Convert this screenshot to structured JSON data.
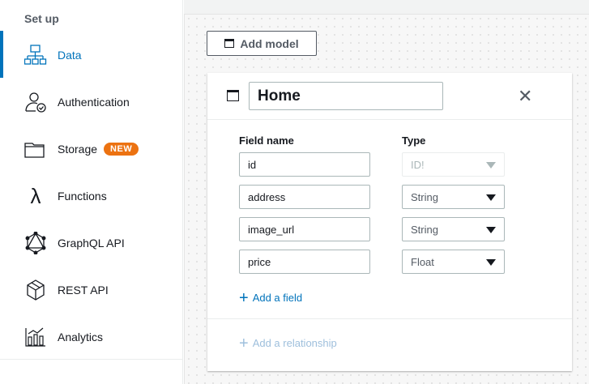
{
  "sidebar": {
    "section": "Set up",
    "items": [
      {
        "label": "Data",
        "icon": "data-icon",
        "active": true
      },
      {
        "label": "Authentication",
        "icon": "authentication-icon"
      },
      {
        "label": "Storage",
        "icon": "folder-icon",
        "badge": "NEW"
      },
      {
        "label": "Functions",
        "icon": "lambda-icon"
      },
      {
        "label": "GraphQL API",
        "icon": "graphql-icon"
      },
      {
        "label": "REST API",
        "icon": "cube-icon"
      },
      {
        "label": "Analytics",
        "icon": "analytics-icon"
      }
    ]
  },
  "toolbar": {
    "add_model": "Add model"
  },
  "model": {
    "name": "Home",
    "col_field": "Field name",
    "col_type": "Type",
    "fields": [
      {
        "name": "id",
        "type": "ID!"
      },
      {
        "name": "address",
        "type": "String"
      },
      {
        "name": "image_url",
        "type": "String"
      },
      {
        "name": "price",
        "type": "Float"
      }
    ],
    "add_field": "Add a field",
    "add_relationship": "Add a relationship"
  },
  "colors": {
    "accent": "#0073bb",
    "badge": "#ec7211"
  }
}
